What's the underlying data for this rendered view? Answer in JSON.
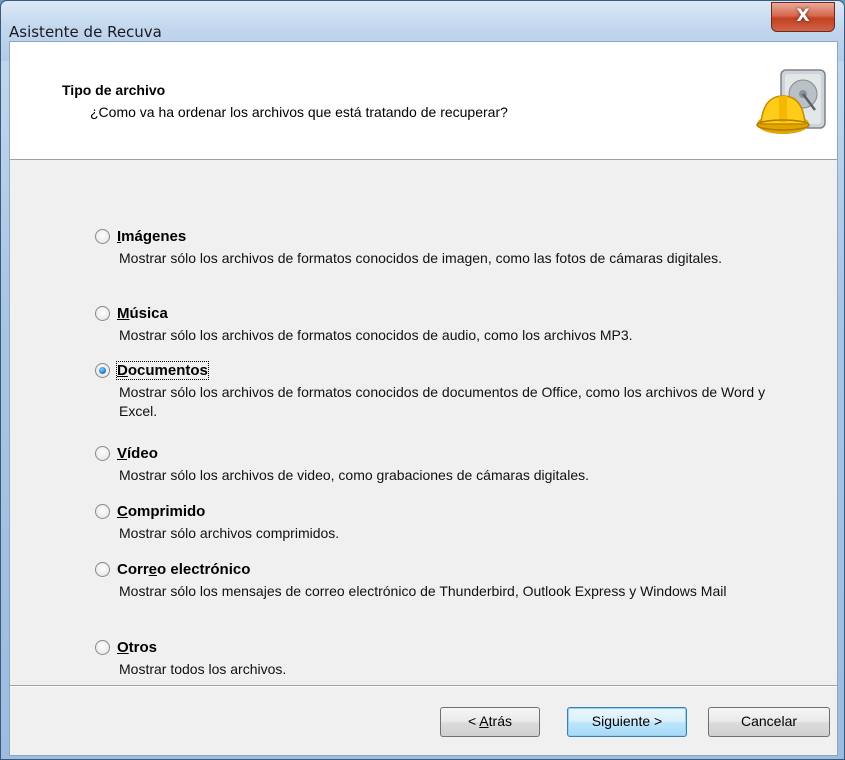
{
  "window": {
    "title": "Asistente de Recuva",
    "close_label": "X"
  },
  "header": {
    "title": "Tipo de archivo",
    "subtitle": "¿Como va ha ordenar los archivos que está tratando de recuperar?",
    "logo_icon": "recuva-harddisk-hardhat-icon"
  },
  "options": [
    {
      "label_first": "I",
      "label_rest": "mágenes",
      "description": "Mostrar sólo los archivos de formatos conocidos de imagen, como las fotos de cámaras digitales.",
      "selected": false
    },
    {
      "label_first": "M",
      "label_rest": "úsica",
      "description": "Mostrar sólo los archivos de formatos conocidos de audio, como los archivos MP3.",
      "selected": false
    },
    {
      "label_first": "D",
      "label_rest": "ocumentos",
      "description": "Mostrar sólo los archivos de formatos conocidos de documentos de Office, como los archivos de Word y Excel.",
      "selected": true
    },
    {
      "label_first": "V",
      "label_rest": "ídeo",
      "description": "Mostrar sólo los archivos de video, como grabaciones de cámaras digitales.",
      "selected": false
    },
    {
      "label_first": "C",
      "label_rest": "omprimido",
      "description": "Mostrar sólo archivos comprimidos.",
      "selected": false
    },
    {
      "label_pre": "Corr",
      "label_mid": "e",
      "label_post": "o electrónico",
      "description": "Mostrar sólo los mensajes de correo electrónico de Thunderbird, Outlook Express y Windows Mail",
      "selected": false
    },
    {
      "label_first": "O",
      "label_rest": "tros",
      "description": "Mostrar todos los archivos.",
      "selected": false
    }
  ],
  "buttons": {
    "back_pre": "< ",
    "back_u": "A",
    "back_post": "trás",
    "next": "Siguiente >",
    "cancel": "Cancelar"
  },
  "colors": {
    "selected_radio": "#1f7fd4",
    "close_button": "#c2401f",
    "default_button_border": "#3c7fb1"
  }
}
